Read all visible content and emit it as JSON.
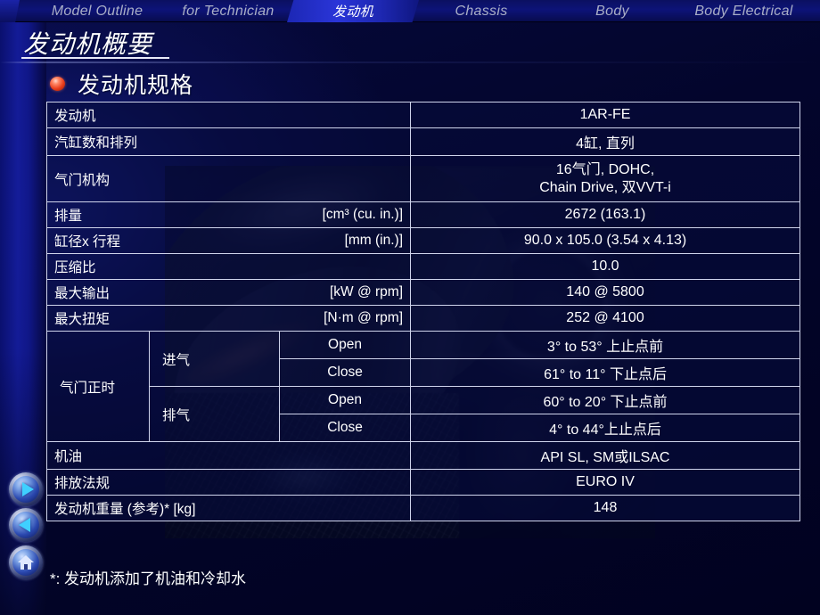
{
  "tabs": [
    {
      "label": "Model Outline",
      "active": false
    },
    {
      "label": "for Technician",
      "active": false
    },
    {
      "label": "发动机",
      "active": true
    },
    {
      "label": "Chassis",
      "active": false
    },
    {
      "label": "Body",
      "active": false
    },
    {
      "label": "Body Electrical",
      "active": false
    }
  ],
  "page_title": "发动机概要",
  "section_heading": "发动机规格",
  "footnote": "*: 发动机添加了机油和冷却水",
  "nav": {
    "forward_label": "forward-arrow-icon",
    "back_label": "back-arrow-icon",
    "home_label": "home-icon"
  },
  "colors": {
    "background": "#010225",
    "accent_blue": "#141c9a",
    "active_tab": "#2a35d8",
    "bullet_red": "#e83d1c",
    "table_border": "#cfd4ec",
    "text": "#ffffff",
    "tab_inactive_text": "#a9aec6"
  },
  "table": {
    "rows": [
      {
        "key": "发动机",
        "unit": "",
        "value": "1AR-FE"
      },
      {
        "key": "汽缸数和排列",
        "unit": "",
        "value": "4缸, 直列"
      },
      {
        "key": "气门机构",
        "unit": "",
        "value": "16气门, DOHC,\nChain Drive, 双VVT-i"
      },
      {
        "key": "排量",
        "unit": "[cm³ (cu. in.)]",
        "value": "2672 (163.1)"
      },
      {
        "key": "缸径x 行程",
        "unit": "[mm (in.)]",
        "value": "90.0 x 105.0 (3.54 x 4.13)"
      },
      {
        "key": "压缩比",
        "unit": "",
        "value": "10.0"
      },
      {
        "key": "最大输出",
        "unit": "[kW @ rpm]",
        "value": "140 @ 5800"
      },
      {
        "key": "最大扭矩",
        "unit": "[N·m @ rpm]",
        "value": "252 @ 4100"
      }
    ],
    "valve_timing": {
      "label": "气门正时",
      "groups": [
        {
          "name": "进气",
          "entries": [
            {
              "action": "Open",
              "value": "3° to 53° 上止点前"
            },
            {
              "action": "Close",
              "value": "61° to 11° 下止点后"
            }
          ]
        },
        {
          "name": "排气",
          "entries": [
            {
              "action": "Open",
              "value": "60° to 20° 下止点前"
            },
            {
              "action": "Close",
              "value": "4° to 44°上止点后"
            }
          ]
        }
      ]
    },
    "rows_tail": [
      {
        "key": "机油",
        "unit": "",
        "value": "API SL, SM或ILSAC"
      },
      {
        "key": "排放法规",
        "unit": "",
        "value": "EURO IV"
      },
      {
        "key": "发动机重量 (参考)* [kg]",
        "unit": "",
        "value": "148"
      }
    ]
  }
}
